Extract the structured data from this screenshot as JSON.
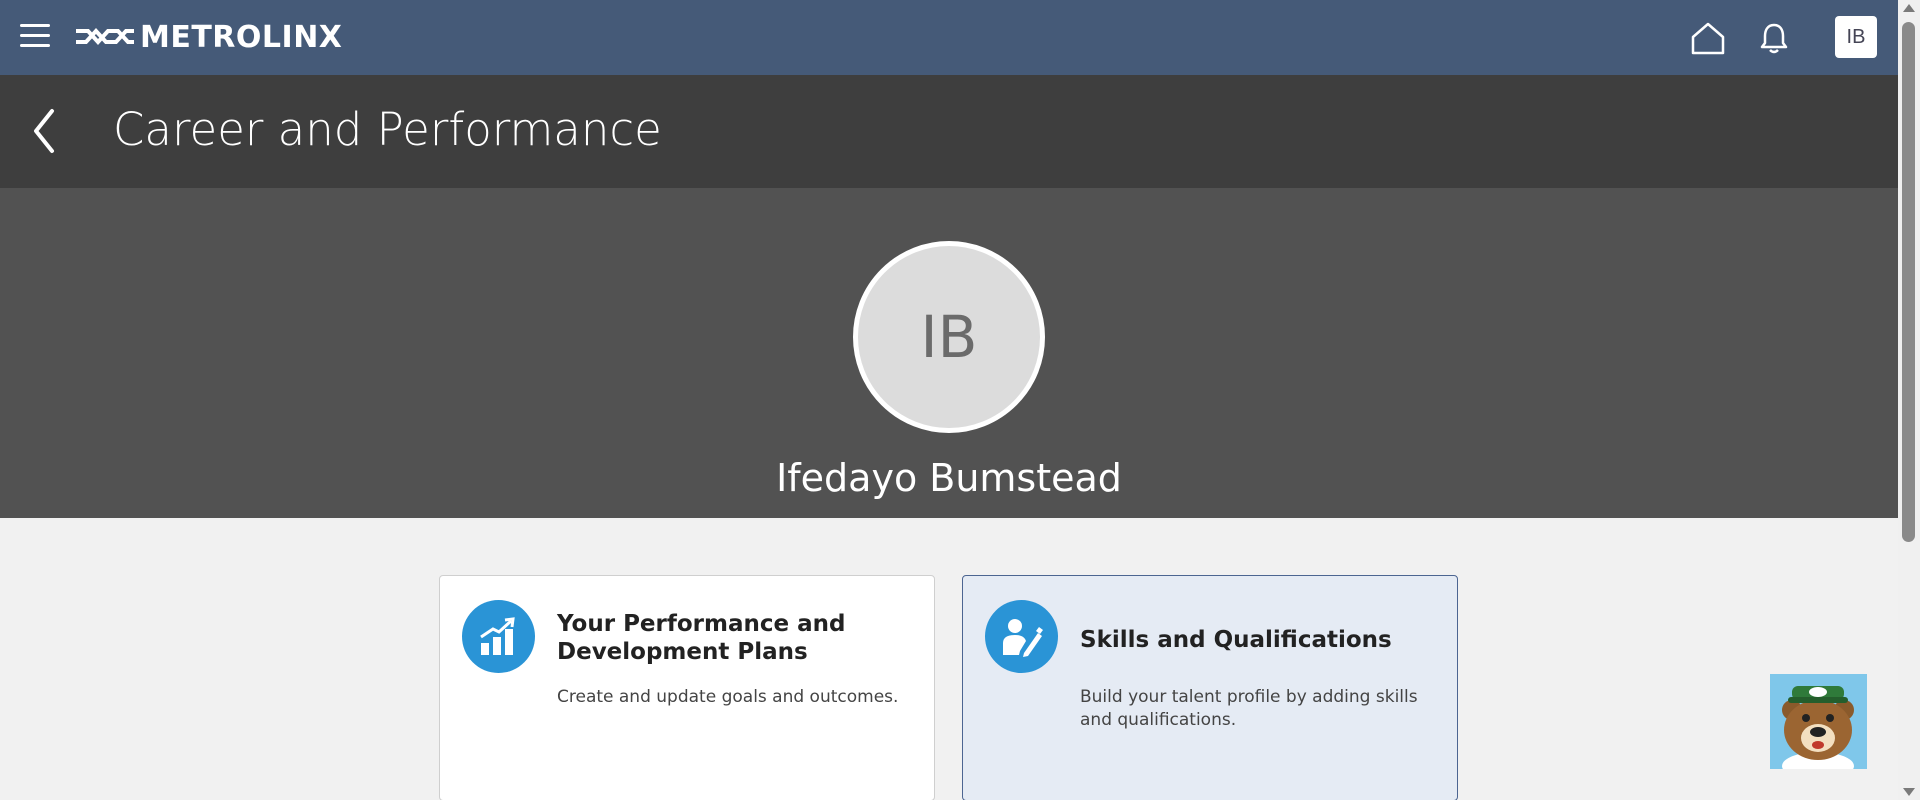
{
  "header": {
    "brand": "METROLINX",
    "user_initials": "IB"
  },
  "page": {
    "title": "Career and Performance"
  },
  "profile": {
    "initials": "IB",
    "name": "Ifedayo Bumstead"
  },
  "cards": [
    {
      "title": "Your Performance and Development Plans",
      "description": "Create and update goals and outcomes.",
      "icon": "chart-growth-icon",
      "selected": false
    },
    {
      "title": "Skills and Qualifications",
      "description": "Build your talent profile by adding skills and qualifications.",
      "icon": "person-edit-icon",
      "selected": true
    }
  ],
  "colors": {
    "topbar": "#455a78",
    "titlebar": "#3e3e3e",
    "banner": "#525252",
    "icon_circle": "#2a94d6",
    "selected_card": "#e5ebf4"
  }
}
